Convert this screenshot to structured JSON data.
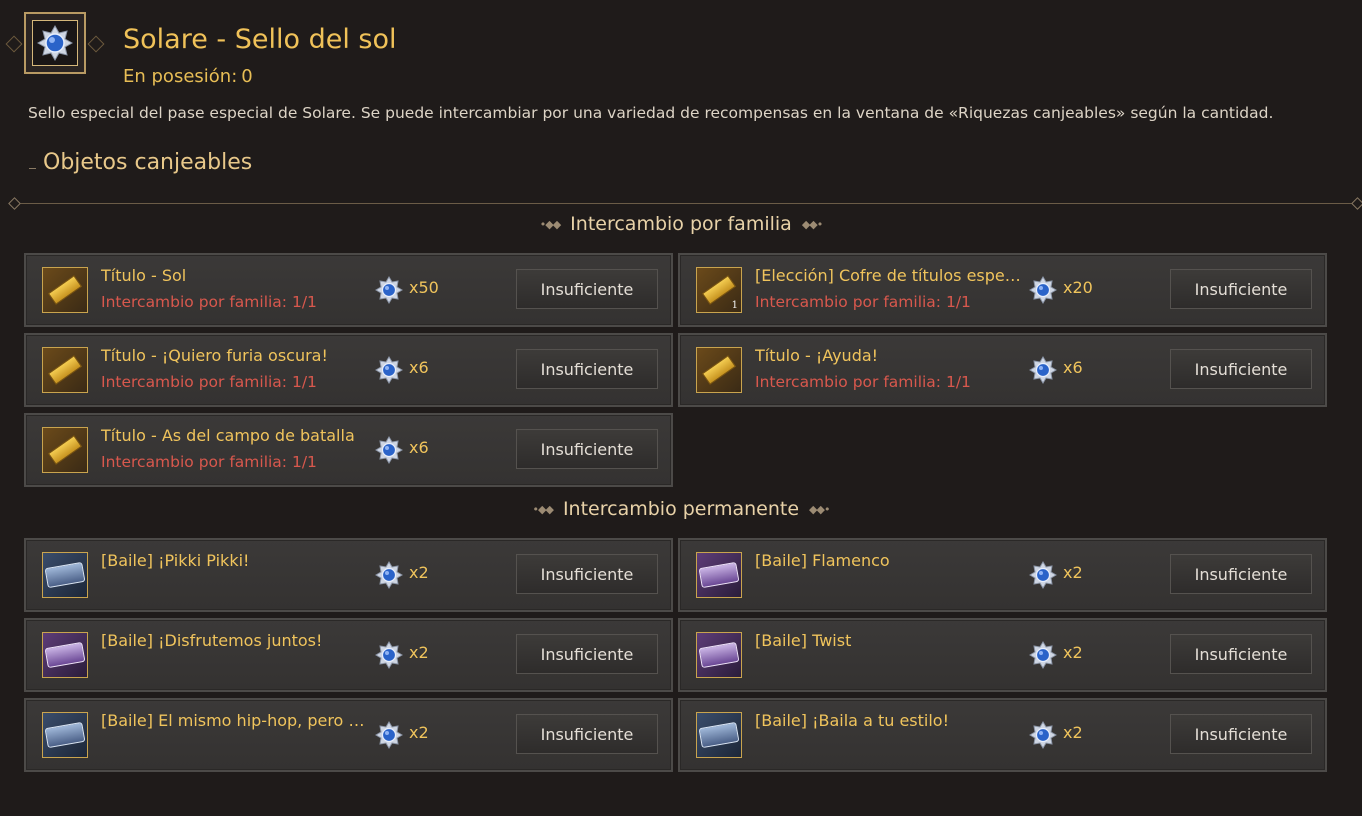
{
  "header": {
    "icon": "sun-seal-icon",
    "title": "Solare - Sello del sol",
    "owned_label": "En posesión:",
    "owned_value": "0",
    "description": "Sello especial del pase especial de Solare. Se puede intercambiar por una variedad de recompensas en la ventana de «Riquezas canjeables» según la cantidad."
  },
  "section": {
    "title": "Objetos canjeables"
  },
  "groups": [
    {
      "title": "Intercambio por familia",
      "items": [
        {
          "name": "Título - Sol",
          "limit": "Intercambio por familia: 1/1",
          "cost": "x50",
          "button": "Insuficiente",
          "icon": "gold-title-ticket-icon",
          "qty": ""
        },
        {
          "name": "[Elección] Cofre de títulos espec...",
          "limit": "Intercambio por familia: 1/1",
          "cost": "x20",
          "button": "Insuficiente",
          "icon": "gold-title-ticket-icon",
          "qty": "1"
        },
        {
          "name": "Título - ¡Quiero furia oscura!",
          "limit": "Intercambio por familia: 1/1",
          "cost": "x6",
          "button": "Insuficiente",
          "icon": "gold-title-ticket-icon",
          "qty": ""
        },
        {
          "name": "Título - ¡Ayuda!",
          "limit": "Intercambio por familia: 1/1",
          "cost": "x6",
          "button": "Insuficiente",
          "icon": "gold-title-ticket-icon",
          "qty": ""
        },
        {
          "name": "Título - As del campo de batalla",
          "limit": "Intercambio por familia: 1/1",
          "cost": "x6",
          "button": "Insuficiente",
          "icon": "gold-title-ticket-icon",
          "qty": ""
        }
      ]
    },
    {
      "title": "Intercambio permanente",
      "items": [
        {
          "name": "[Baile] ¡Pikki Pikki!",
          "limit": "",
          "cost": "x2",
          "button": "Insuficiente",
          "icon": "blue-dance-ticket-icon",
          "qty": ""
        },
        {
          "name": "[Baile] Flamenco",
          "limit": "",
          "cost": "x2",
          "button": "Insuficiente",
          "icon": "purple-dance-ticket-icon",
          "qty": ""
        },
        {
          "name": "[Baile] ¡Disfrutemos juntos!",
          "limit": "",
          "cost": "x2",
          "button": "Insuficiente",
          "icon": "purple-dance-ticket-icon",
          "qty": ""
        },
        {
          "name": "[Baile] Twist",
          "limit": "",
          "cost": "x2",
          "button": "Insuficiente",
          "icon": "purple-dance-ticket-icon",
          "qty": ""
        },
        {
          "name": "[Baile] El mismo hip-hop, pero d...",
          "limit": "",
          "cost": "x2",
          "button": "Insuficiente",
          "icon": "blue-dance-ticket-icon",
          "qty": ""
        },
        {
          "name": "[Baile] ¡Baila a tu estilo!",
          "limit": "",
          "cost": "x2",
          "button": "Insuficiente",
          "icon": "blue-dance-ticket-icon",
          "qty": ""
        }
      ]
    }
  ],
  "colors": {
    "gold_text": "#f0c45c",
    "limit_red": "#d8584d",
    "background": "#1f1b1a",
    "card": "#3b3938"
  }
}
